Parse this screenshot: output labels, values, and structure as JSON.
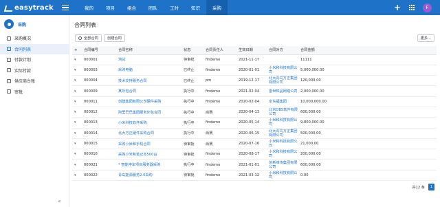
{
  "app": {
    "name": "easytrack"
  },
  "nav": {
    "items": [
      "我的",
      "项目",
      "组合",
      "团队",
      "工时",
      "知识",
      "采购"
    ]
  },
  "user": {
    "initial": "F"
  },
  "sidebar": {
    "module": "采购",
    "items": [
      {
        "label": "采购概况"
      },
      {
        "label": "合同列表"
      },
      {
        "label": "付款计划"
      },
      {
        "label": "实际付款"
      },
      {
        "label": "供应商台账"
      },
      {
        "label": "审批"
      }
    ],
    "collapse": "«"
  },
  "main": {
    "title": "合同列表",
    "btn_all": "全部合同",
    "btn_create": "创建合同",
    "btn_more": "更多..."
  },
  "table": {
    "headers": [
      "合同编号",
      "合同名称",
      "状态",
      "合同责任人",
      "生效日期",
      "合同对方",
      "合同金额"
    ],
    "sort_mark": "≑",
    "rows": [
      [
        "000001",
        "测试",
        "待审批",
        "findemo",
        "2021-11-17",
        "",
        "11111"
      ],
      [
        "000003",
        "采购电脑",
        "已终止",
        "findemo",
        "2020-01-01",
        "小米和科技有限公司",
        "5,000,000.00"
      ],
      [
        "000004",
        "技术支持服务合同",
        "已终止",
        "pm",
        "2019-12-17",
        "北大青鸟方正集团有限公司",
        "120,000.00"
      ],
      [
        "000009",
        "某外包合同",
        "执行中",
        "findemo",
        "2021-02-04",
        "雷世知品网络公司",
        "2,000,000.00"
      ],
      [
        "000011",
        "创建集团有限公司硬件采购",
        "执行中",
        "findemo",
        "2020-02-04",
        "京东福集团",
        "10,000,000.00"
      ],
      [
        "000012",
        "阿里巴巴集团服务外包合同",
        "执行中",
        "尚赛",
        "2020-04-13",
        "北京OBS软件有限公司",
        "600,000.00"
      ],
      [
        "000013",
        "小米科技软件采购",
        "执行中",
        "findemo",
        "2020-05-14",
        "小米和科技有限公司",
        "9,800,000.00"
      ],
      [
        "000014",
        "北大方正硬件采购合同",
        "执行中",
        "尚赛",
        "2020-06-15",
        "北大青鸟方正集团有限公司",
        "500,000.00"
      ],
      [
        "000015",
        "采购小米和手机合同",
        "待审批",
        "尚赛",
        "2020-07-16",
        "小米和科技有限公司",
        "21,000.00"
      ],
      [
        "000016",
        "采购小米和笔记本500台",
        "待审批",
        "findemo",
        "2020-08-17",
        "小米和科技有限公司",
        "200,000.00"
      ],
      [
        "000021",
        "* 智能停车项目服务器采购",
        "执行中",
        "findemo",
        "2021-01-01",
        "创新维传集团有限公司",
        "600,000.00"
      ],
      [
        "000022",
        "青岛能源服务2.0采购",
        "待审批",
        "findemo",
        "2021-03-12",
        "小米和科技有限公司",
        "0.00"
      ]
    ]
  },
  "footer": {
    "total": "共12 条",
    "page": "1"
  },
  "colors": {
    "primary": "#1e73c8",
    "avatar": "#9c5bd1"
  }
}
